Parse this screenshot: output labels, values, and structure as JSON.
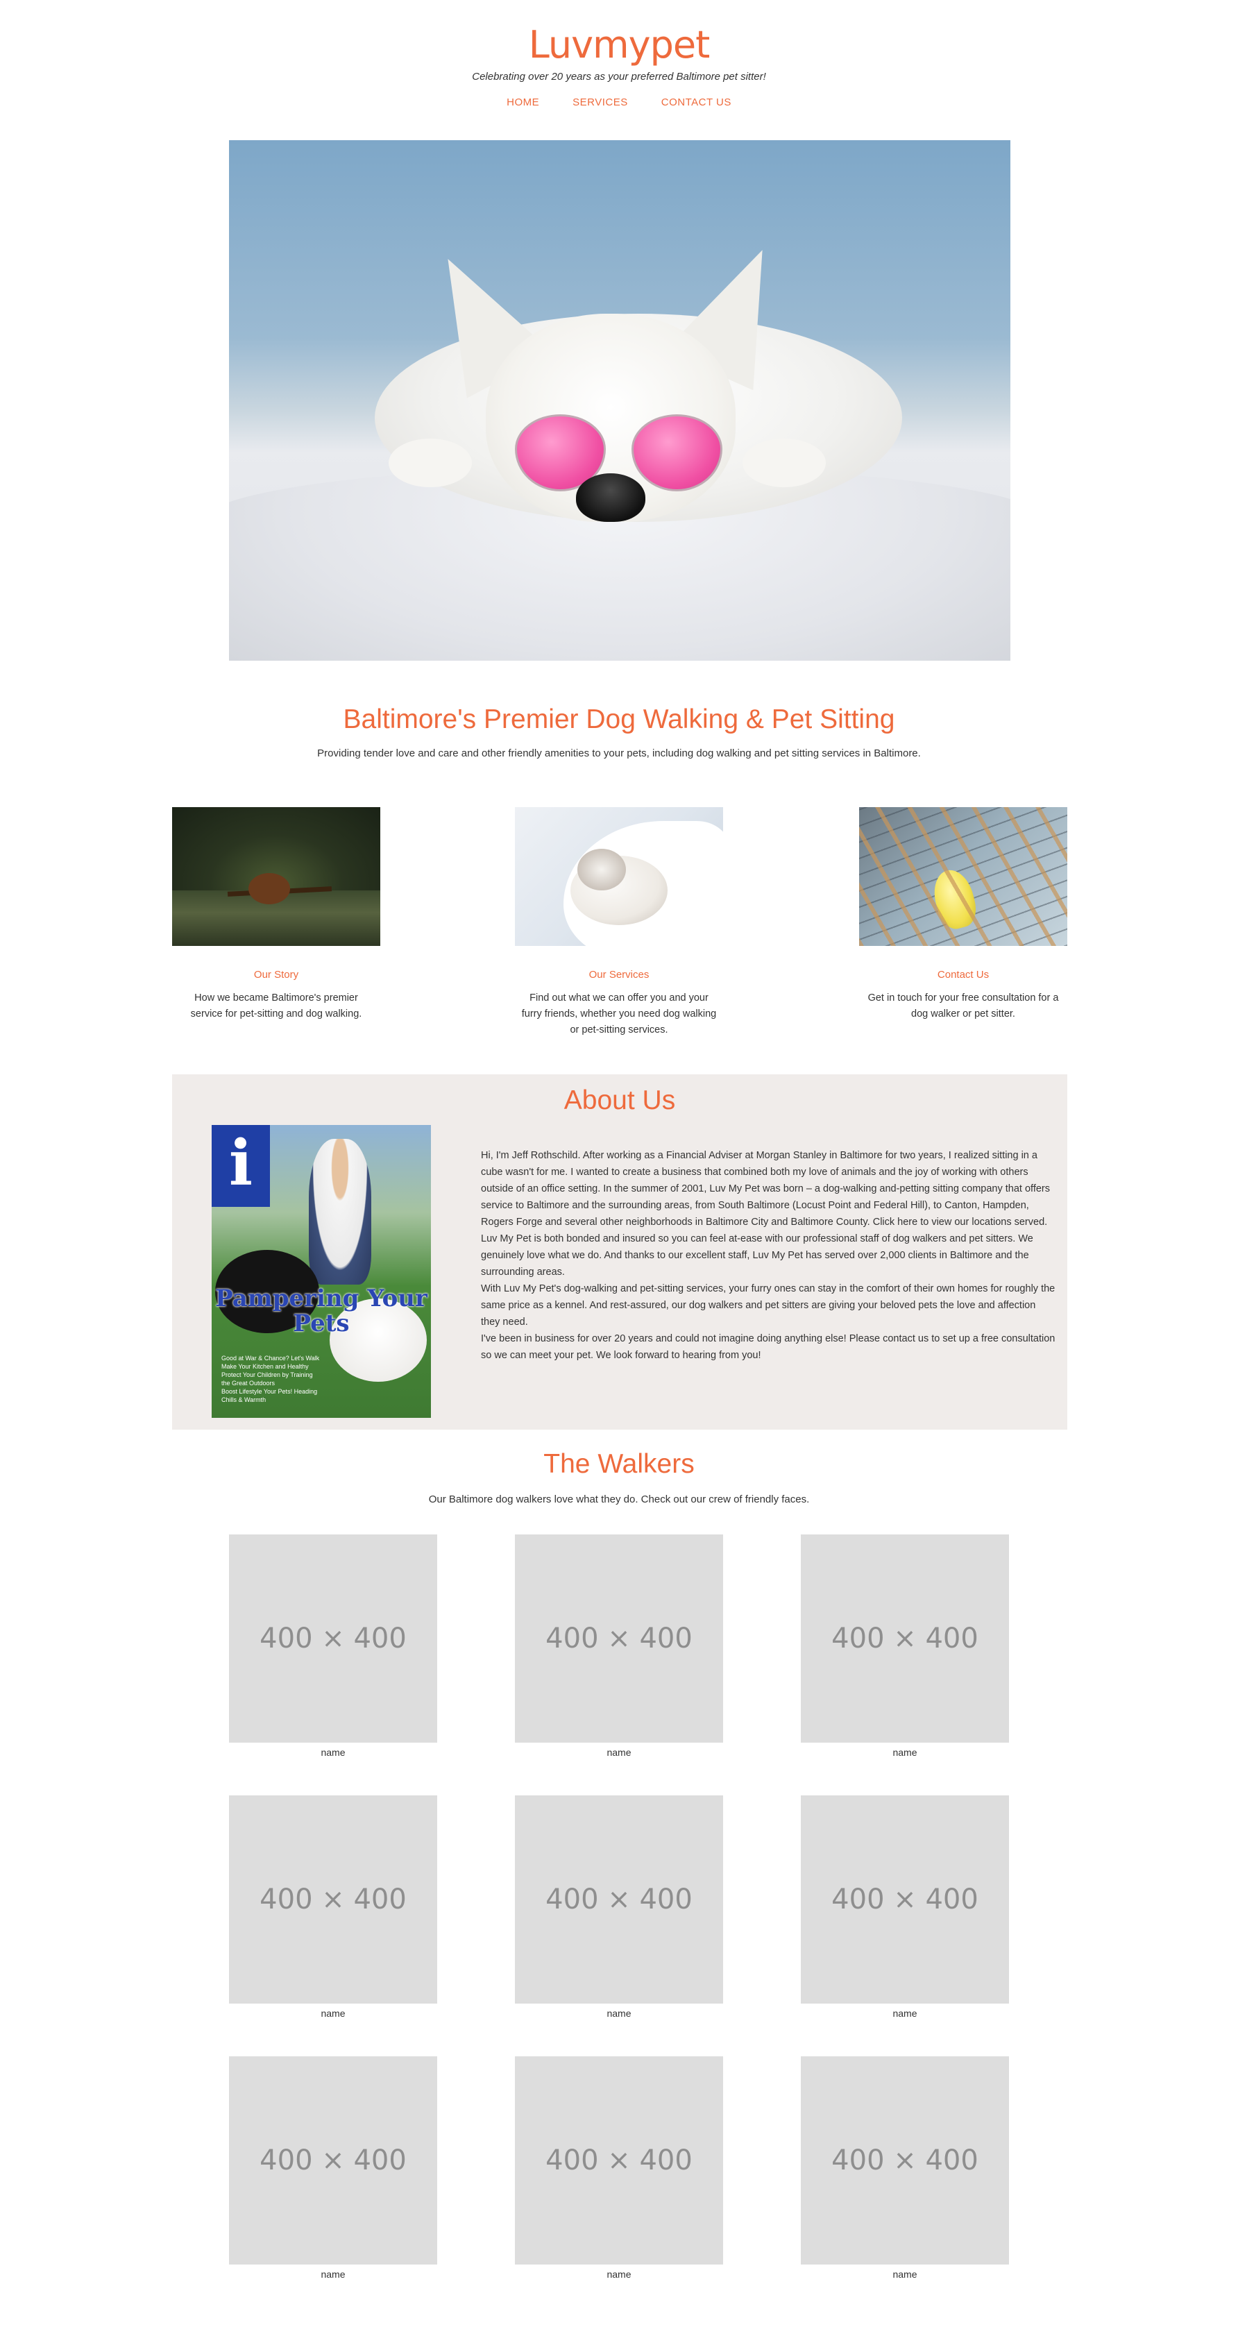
{
  "header": {
    "logo": "Luvmypet",
    "tagline": "Celebrating over 20 years as your preferred Baltimore pet sitter!",
    "nav": [
      "HOME",
      "SERVICES",
      "CONTACT US"
    ]
  },
  "intro": {
    "title": "Baltimore's Premier Dog Walking & Pet Sitting",
    "subtitle": "Providing tender love and care and other friendly amenities to your pets, including dog walking and pet sitting services in Baltimore."
  },
  "features": [
    {
      "title": "Our Story",
      "desc": "How we became Baltimore's premier service for pet-sitting and dog walking."
    },
    {
      "title": "Our Services",
      "desc": "Find out what we can offer you and your furry friends, whether you need dog walking or pet-sitting services."
    },
    {
      "title": "Contact Us",
      "desc": "Get in touch for your free consultation for a dog walker or pet sitter."
    }
  ],
  "about": {
    "title": "About Us",
    "magazine": {
      "masthead": "i",
      "cover_title": "Pampering Your Pets",
      "cover_lines": [
        "Good at War & Chance? Let's Walk",
        "Make Your Kitchen and Healthy",
        "Protect Your Children by Training",
        "the Great Outdoors",
        "Boost Lifestyle Your Pets! Heading",
        "Chills & Warmth"
      ]
    },
    "paragraphs": [
      "Hi, I'm Jeff Rothschild. After working as a Financial Adviser at Morgan Stanley in Baltimore for two years, I realized sitting in a cube wasn't for me. I wanted to create a business that combined both my love of animals and the joy of working with others outside of an office setting. In the summer of 2001, Luv My Pet was born – a dog-walking and-petting sitting company that offers service to Baltimore and the surrounding areas, from South Baltimore (Locust Point and Federal Hill), to Canton, Hampden, Rogers Forge and several other neighborhoods in Baltimore City and Baltimore County. Click here to view our locations served.",
      "Luv My Pet is both bonded and insured so you can feel at-ease with our professional staff of dog walkers and pet sitters. We genuinely love what we do. And thanks to our excellent staff, Luv My Pet has served over 2,000 clients in Baltimore and the surrounding areas.",
      "With Luv My Pet's dog-walking and pet-sitting services, your furry ones can stay in the comfort of their own homes for roughly the same price as a kennel. And rest-assured, our dog walkers and pet sitters are giving your beloved pets the love and affection they need.",
      "I've been in business for over 20 years and could not imagine doing anything else! Please contact us to set up a free consultation so we can meet your pet. We look forward to hearing from you!"
    ]
  },
  "walkers": {
    "title": "The Walkers",
    "subtitle": "Our Baltimore dog walkers love what they do. Check out our crew of friendly faces.",
    "items": [
      {
        "placeholder": "400 × 400",
        "name": "name"
      },
      {
        "placeholder": "400 × 400",
        "name": "name"
      },
      {
        "placeholder": "400 × 400",
        "name": "name"
      },
      {
        "placeholder": "400 × 400",
        "name": "name"
      },
      {
        "placeholder": "400 × 400",
        "name": "name"
      },
      {
        "placeholder": "400 × 400",
        "name": "name"
      },
      {
        "placeholder": "400 × 400",
        "name": "name"
      },
      {
        "placeholder": "400 × 400",
        "name": "name"
      },
      {
        "placeholder": "400 × 400",
        "name": "name"
      }
    ]
  },
  "colors": {
    "accent": "#ee6a3c",
    "about_bg": "#f0ecea",
    "placeholder_bg": "#dddddd"
  }
}
